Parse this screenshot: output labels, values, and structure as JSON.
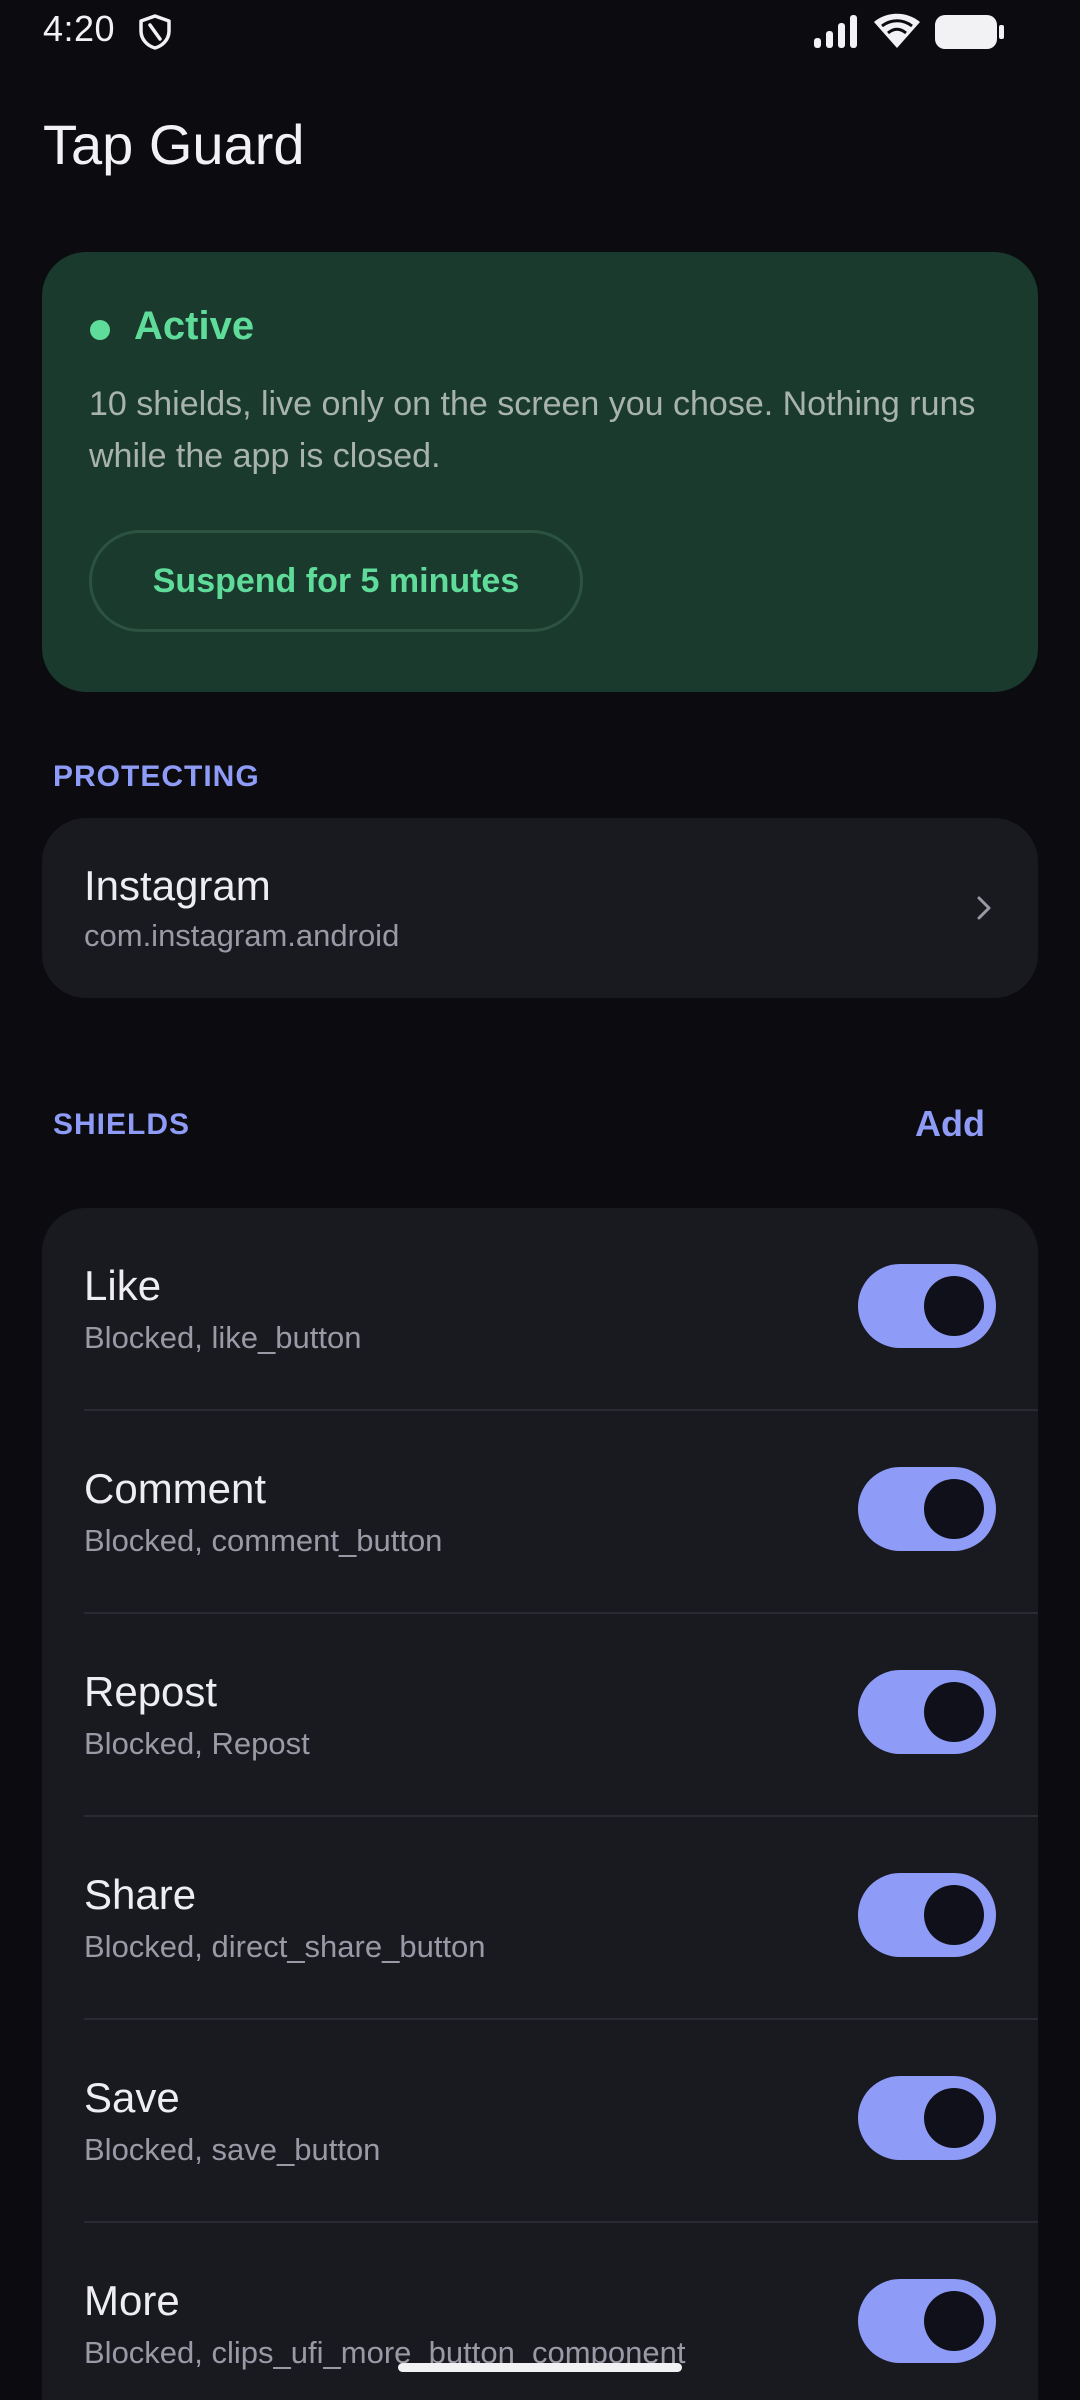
{
  "status_bar": {
    "time": "4:20",
    "icons": [
      "shield-icon",
      "signal-icon",
      "wifi-icon",
      "battery-icon"
    ]
  },
  "app": {
    "title": "Tap Guard"
  },
  "active_card": {
    "status": "Active",
    "description": "10 shields, live only on the screen you chose. Nothing runs while the app is closed.",
    "suspend_label": "Suspend for 5 minutes",
    "accent_color": "#5fdc9a",
    "background_color": "#1a3a2d"
  },
  "protecting": {
    "header": "PROTECTING",
    "app_name": "Instagram",
    "package": "com.instagram.android"
  },
  "shields": {
    "header": "SHIELDS",
    "add_label": "Add",
    "accent_color": "#8e9cf7",
    "items": [
      {
        "name": "Like",
        "detail": "Blocked, like_button",
        "enabled": true
      },
      {
        "name": "Comment",
        "detail": "Blocked, comment_button",
        "enabled": true
      },
      {
        "name": "Repost",
        "detail": "Blocked, Repost",
        "enabled": true
      },
      {
        "name": "Share",
        "detail": "Blocked, direct_share_button",
        "enabled": true
      },
      {
        "name": "Save",
        "detail": "Blocked, save_button",
        "enabled": true
      },
      {
        "name": "More",
        "detail": "Blocked, clips_ufi_more_button_component",
        "enabled": true
      }
    ]
  }
}
